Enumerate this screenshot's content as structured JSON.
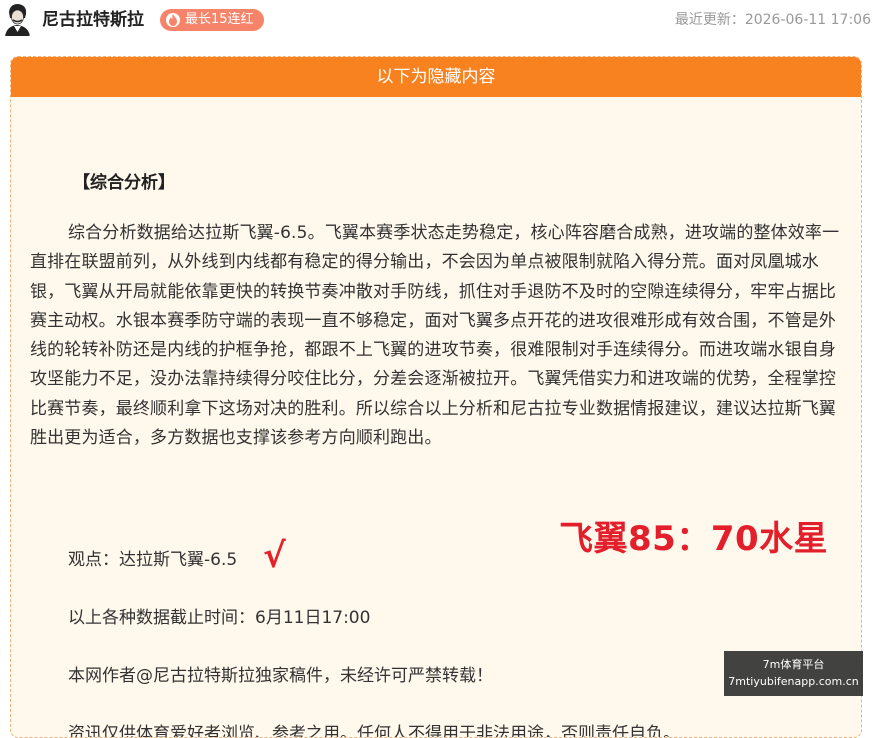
{
  "header": {
    "author": "尼古拉特斯拉",
    "streak_badge": "最长15连红",
    "updated_label": "最近更新：",
    "updated_time": "2026-06-11 17:06"
  },
  "card": {
    "banner": "以下为隐藏内容",
    "section_title": "【综合分析】",
    "analysis": "综合分析数据给达拉斯飞翼-6.5。飞翼本赛季状态走势稳定，核心阵容磨合成熟，进攻端的整体效率一直排在联盟前列，从外线到内线都有稳定的得分输出，不会因为单点被限制就陷入得分荒。面对凤凰城水银，飞翼从开局就能依靠更快的转换节奏冲散对手防线，抓住对手退防不及时的空隙连续得分，牢牢占据比赛主动权。水银本赛季防守端的表现一直不够稳定，面对飞翼多点开花的进攻很难形成有效合围，不管是外线的轮转补防还是内线的护框争抢，都跟不上飞翼的进攻节奏，很难限制对手连续得分。而进攻端水银自身攻坚能力不足，没办法靠持续得分咬住比分，分差会逐渐被拉开。飞翼凭借实力和进攻端的优势，全程掌控比赛节奏，最终顺利拿下这场对决的胜利。所以综合以上分析和尼古拉专业数据情报建议，建议达拉斯飞翼胜出更为适合，多方数据也支撑该参考方向顺利跑出。",
    "opinion": "观点：达拉斯飞翼-6.5",
    "check_mark": "√",
    "score_text": "飞翼85：70水星",
    "cutoff": "以上各种数据截止时间：6月11日17:00",
    "copyright": "本网作者@尼古拉特斯拉独家稿件，未经许可严禁转载！",
    "disclaimer": "资讯仅供体育爱好者浏览、参考之用。任何人不得用于非法用途，否则责任自负。"
  },
  "watermark": {
    "line1": "7m体育平台",
    "line2": "7mtiyubifenapp.com.cn"
  },
  "colors": {
    "banner": "#f7821f",
    "card_bg": "#fff8ec",
    "badge": "#f6846a",
    "highlight_red": "#e21f2a"
  },
  "icons": {
    "avatar": "portrait-avatar-icon",
    "streak": "flame-icon"
  }
}
